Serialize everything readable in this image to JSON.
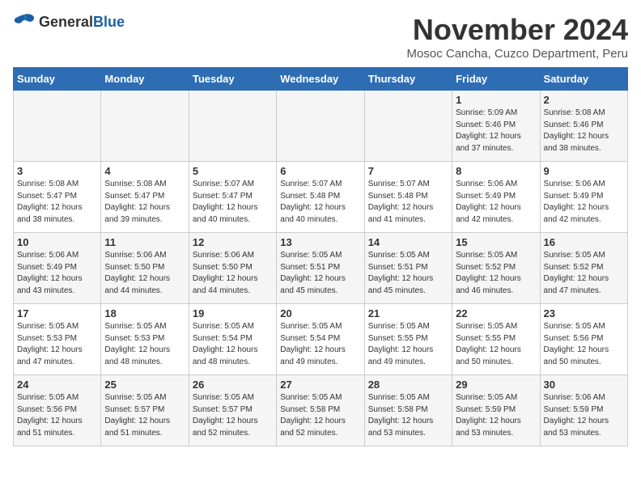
{
  "header": {
    "logo_general": "General",
    "logo_blue": "Blue",
    "month_title": "November 2024",
    "location": "Mosoc Cancha, Cuzco Department, Peru"
  },
  "weekdays": [
    "Sunday",
    "Monday",
    "Tuesday",
    "Wednesday",
    "Thursday",
    "Friday",
    "Saturday"
  ],
  "weeks": [
    [
      {
        "day": "",
        "info": ""
      },
      {
        "day": "",
        "info": ""
      },
      {
        "day": "",
        "info": ""
      },
      {
        "day": "",
        "info": ""
      },
      {
        "day": "",
        "info": ""
      },
      {
        "day": "1",
        "info": "Sunrise: 5:09 AM\nSunset: 5:46 PM\nDaylight: 12 hours\nand 37 minutes."
      },
      {
        "day": "2",
        "info": "Sunrise: 5:08 AM\nSunset: 5:46 PM\nDaylight: 12 hours\nand 38 minutes."
      }
    ],
    [
      {
        "day": "3",
        "info": "Sunrise: 5:08 AM\nSunset: 5:47 PM\nDaylight: 12 hours\nand 38 minutes."
      },
      {
        "day": "4",
        "info": "Sunrise: 5:08 AM\nSunset: 5:47 PM\nDaylight: 12 hours\nand 39 minutes."
      },
      {
        "day": "5",
        "info": "Sunrise: 5:07 AM\nSunset: 5:47 PM\nDaylight: 12 hours\nand 40 minutes."
      },
      {
        "day": "6",
        "info": "Sunrise: 5:07 AM\nSunset: 5:48 PM\nDaylight: 12 hours\nand 40 minutes."
      },
      {
        "day": "7",
        "info": "Sunrise: 5:07 AM\nSunset: 5:48 PM\nDaylight: 12 hours\nand 41 minutes."
      },
      {
        "day": "8",
        "info": "Sunrise: 5:06 AM\nSunset: 5:49 PM\nDaylight: 12 hours\nand 42 minutes."
      },
      {
        "day": "9",
        "info": "Sunrise: 5:06 AM\nSunset: 5:49 PM\nDaylight: 12 hours\nand 42 minutes."
      }
    ],
    [
      {
        "day": "10",
        "info": "Sunrise: 5:06 AM\nSunset: 5:49 PM\nDaylight: 12 hours\nand 43 minutes."
      },
      {
        "day": "11",
        "info": "Sunrise: 5:06 AM\nSunset: 5:50 PM\nDaylight: 12 hours\nand 44 minutes."
      },
      {
        "day": "12",
        "info": "Sunrise: 5:06 AM\nSunset: 5:50 PM\nDaylight: 12 hours\nand 44 minutes."
      },
      {
        "day": "13",
        "info": "Sunrise: 5:05 AM\nSunset: 5:51 PM\nDaylight: 12 hours\nand 45 minutes."
      },
      {
        "day": "14",
        "info": "Sunrise: 5:05 AM\nSunset: 5:51 PM\nDaylight: 12 hours\nand 45 minutes."
      },
      {
        "day": "15",
        "info": "Sunrise: 5:05 AM\nSunset: 5:52 PM\nDaylight: 12 hours\nand 46 minutes."
      },
      {
        "day": "16",
        "info": "Sunrise: 5:05 AM\nSunset: 5:52 PM\nDaylight: 12 hours\nand 47 minutes."
      }
    ],
    [
      {
        "day": "17",
        "info": "Sunrise: 5:05 AM\nSunset: 5:53 PM\nDaylight: 12 hours\nand 47 minutes."
      },
      {
        "day": "18",
        "info": "Sunrise: 5:05 AM\nSunset: 5:53 PM\nDaylight: 12 hours\nand 48 minutes."
      },
      {
        "day": "19",
        "info": "Sunrise: 5:05 AM\nSunset: 5:54 PM\nDaylight: 12 hours\nand 48 minutes."
      },
      {
        "day": "20",
        "info": "Sunrise: 5:05 AM\nSunset: 5:54 PM\nDaylight: 12 hours\nand 49 minutes."
      },
      {
        "day": "21",
        "info": "Sunrise: 5:05 AM\nSunset: 5:55 PM\nDaylight: 12 hours\nand 49 minutes."
      },
      {
        "day": "22",
        "info": "Sunrise: 5:05 AM\nSunset: 5:55 PM\nDaylight: 12 hours\nand 50 minutes."
      },
      {
        "day": "23",
        "info": "Sunrise: 5:05 AM\nSunset: 5:56 PM\nDaylight: 12 hours\nand 50 minutes."
      }
    ],
    [
      {
        "day": "24",
        "info": "Sunrise: 5:05 AM\nSunset: 5:56 PM\nDaylight: 12 hours\nand 51 minutes."
      },
      {
        "day": "25",
        "info": "Sunrise: 5:05 AM\nSunset: 5:57 PM\nDaylight: 12 hours\nand 51 minutes."
      },
      {
        "day": "26",
        "info": "Sunrise: 5:05 AM\nSunset: 5:57 PM\nDaylight: 12 hours\nand 52 minutes."
      },
      {
        "day": "27",
        "info": "Sunrise: 5:05 AM\nSunset: 5:58 PM\nDaylight: 12 hours\nand 52 minutes."
      },
      {
        "day": "28",
        "info": "Sunrise: 5:05 AM\nSunset: 5:58 PM\nDaylight: 12 hours\nand 53 minutes."
      },
      {
        "day": "29",
        "info": "Sunrise: 5:05 AM\nSunset: 5:59 PM\nDaylight: 12 hours\nand 53 minutes."
      },
      {
        "day": "30",
        "info": "Sunrise: 5:06 AM\nSunset: 5:59 PM\nDaylight: 12 hours\nand 53 minutes."
      }
    ]
  ]
}
